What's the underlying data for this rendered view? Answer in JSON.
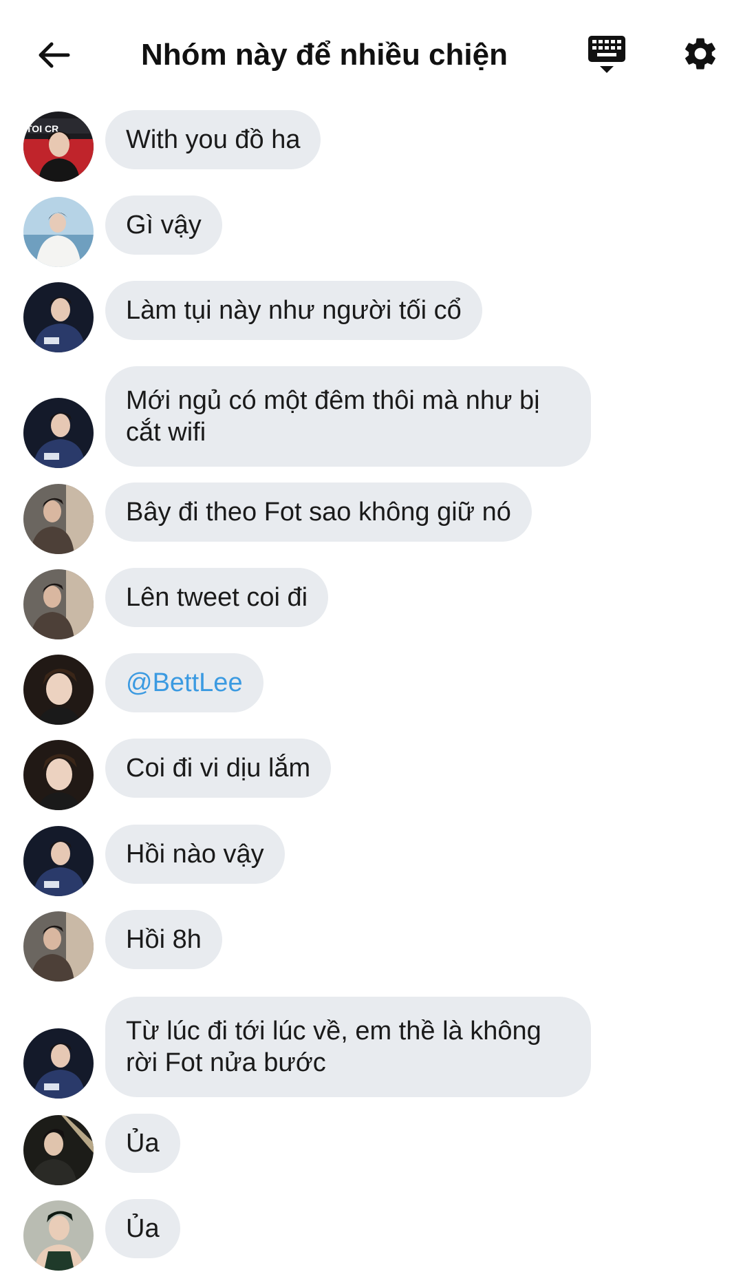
{
  "header": {
    "title": "Nhóm này để nhiều chiện"
  },
  "colors": {
    "bubble_bg": "#e8ebef",
    "mention": "#3b9ae1",
    "text": "#1a1a1a"
  },
  "messages": [
    {
      "text": "With you đồ ha",
      "avatar": "avatar-red-poster"
    },
    {
      "text": "Gì vậy",
      "avatar": "avatar-sea-white-shirt"
    },
    {
      "text": "Làm tụi này như người tối cổ",
      "avatar": "avatar-navy-jacket"
    },
    {
      "text": "Mới ngủ có một đêm thôi mà như bị cắt wifi",
      "avatar": "avatar-navy-jacket"
    },
    {
      "text": "Bây đi theo Fot sao không giữ nó",
      "avatar": "avatar-curtain-tan"
    },
    {
      "text": "Lên tweet coi đi",
      "avatar": "avatar-curtain-tan"
    },
    {
      "text": "@BettLee",
      "avatar": "avatar-dark-portrait"
    },
    {
      "text": "Coi đi vi dịu lắm",
      "avatar": "avatar-dark-portrait"
    },
    {
      "text": "Hồi nào vậy",
      "avatar": "avatar-navy-jacket"
    },
    {
      "text": "Hồi 8h",
      "avatar": "avatar-curtain-tan"
    },
    {
      "text": "Từ lúc đi tới lúc về, em thề là không rời Fot nửa bước",
      "avatar": "avatar-navy-jacket"
    },
    {
      "text": "Ủa",
      "avatar": "avatar-night-street"
    },
    {
      "text": "Ủa",
      "avatar": "avatar-green-tank"
    }
  ]
}
